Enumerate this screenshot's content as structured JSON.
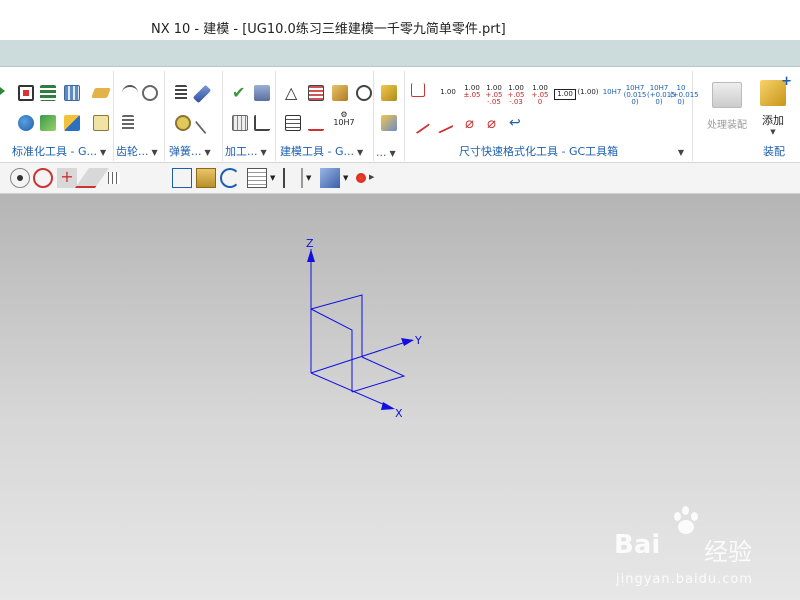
{
  "window": {
    "title": "NX 10 - 建模 - [UG10.0练习三维建模一千零九简单零件.prt]"
  },
  "ribbon": {
    "groups": [
      {
        "label": "标准化工具 - G...",
        "has_dropdown": true
      },
      {
        "label": "齿轮...",
        "has_dropdown": true
      },
      {
        "label": "弹簧...",
        "has_dropdown": true
      },
      {
        "label": "加工...",
        "has_dropdown": true
      },
      {
        "label": "建模工具 - G...",
        "has_dropdown": true
      },
      {
        "label": "...",
        "has_dropdown": true
      },
      {
        "label": "尺寸快速格式化工具 - GC工具箱",
        "has_dropdown": true
      },
      {
        "label": "装配",
        "has_dropdown": false
      }
    ],
    "dim_buttons": [
      {
        "top": "1.00",
        "bottom": ""
      },
      {
        "top": "1.00",
        "bottom": "±.05"
      },
      {
        "top": "1.00",
        "bottom": "+.05 -.05"
      },
      {
        "top": "1.00",
        "bottom": "+.05 -.03"
      },
      {
        "top": "1.00",
        "bottom": "+.05 0"
      },
      {
        "top": "1.00",
        "bottom": "boxed"
      },
      {
        "top": "(1.00)",
        "bottom": ""
      },
      {
        "top": "10H7",
        "bottom": ""
      },
      {
        "top": "10H7",
        "bottom": "(0.015 0)"
      },
      {
        "top": "10H7",
        "bottom": "(+0.015 0)"
      },
      {
        "top": "10",
        "bottom": "(+0.015 0)"
      }
    ],
    "modeling_tol_label": "10H7",
    "assembly": {
      "process_label": "处理装配",
      "add_label": "添加"
    }
  },
  "viewport": {
    "axes": {
      "x": "X",
      "y": "Y",
      "z": "Z"
    },
    "axis_color": "#1010e0"
  },
  "watermark": {
    "brand": "Bai",
    "brand_suffix": "经验",
    "url": "jingyan.baidu.com"
  },
  "colors": {
    "menubar": "#ccdcdc",
    "group_label": "#1c5fb0",
    "viewport_top": "#b5b5b6",
    "viewport_bottom": "#e7e7e7"
  }
}
